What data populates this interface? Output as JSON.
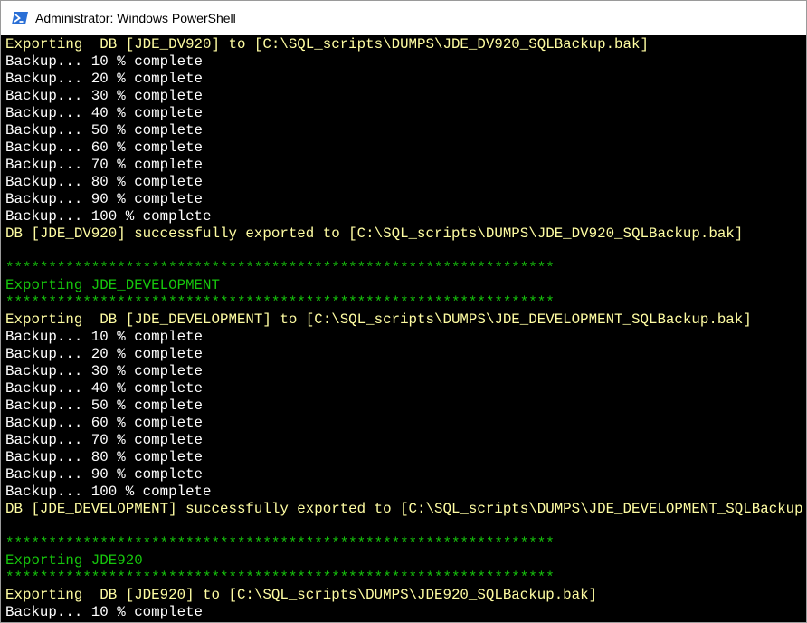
{
  "window": {
    "title": "Administrator: Windows PowerShell",
    "icon": "powershell-icon"
  },
  "colors": {
    "console_bg": "#000000",
    "yellow_text": "#fffda2",
    "green_text": "#16c60c"
  },
  "console": {
    "lines": [
      {
        "text": "Exporting  DB [JDE_DV920] to [C:\\SQL_scripts\\DUMPS\\JDE_DV920_SQLBackup.bak]",
        "color": "yellow"
      },
      {
        "text": "Backup... 10 % complete",
        "color": "white"
      },
      {
        "text": "Backup... 20 % complete",
        "color": "white"
      },
      {
        "text": "Backup... 30 % complete",
        "color": "white"
      },
      {
        "text": "Backup... 40 % complete",
        "color": "white"
      },
      {
        "text": "Backup... 50 % complete",
        "color": "white"
      },
      {
        "text": "Backup... 60 % complete",
        "color": "white"
      },
      {
        "text": "Backup... 70 % complete",
        "color": "white"
      },
      {
        "text": "Backup... 80 % complete",
        "color": "white"
      },
      {
        "text": "Backup... 90 % complete",
        "color": "white"
      },
      {
        "text": "Backup... 100 % complete",
        "color": "white"
      },
      {
        "text": "DB [JDE_DV920] successfully exported to [C:\\SQL_scripts\\DUMPS\\JDE_DV920_SQLBackup.bak]",
        "color": "yellow"
      },
      {
        "text": "",
        "color": "white"
      },
      {
        "text": "****************************************************************",
        "color": "green"
      },
      {
        "text": "Exporting JDE_DEVELOPMENT",
        "color": "green"
      },
      {
        "text": "****************************************************************",
        "color": "green"
      },
      {
        "text": "Exporting  DB [JDE_DEVELOPMENT] to [C:\\SQL_scripts\\DUMPS\\JDE_DEVELOPMENT_SQLBackup.bak]",
        "color": "yellow"
      },
      {
        "text": "Backup... 10 % complete",
        "color": "white"
      },
      {
        "text": "Backup... 20 % complete",
        "color": "white"
      },
      {
        "text": "Backup... 30 % complete",
        "color": "white"
      },
      {
        "text": "Backup... 40 % complete",
        "color": "white"
      },
      {
        "text": "Backup... 50 % complete",
        "color": "white"
      },
      {
        "text": "Backup... 60 % complete",
        "color": "white"
      },
      {
        "text": "Backup... 70 % complete",
        "color": "white"
      },
      {
        "text": "Backup... 80 % complete",
        "color": "white"
      },
      {
        "text": "Backup... 90 % complete",
        "color": "white"
      },
      {
        "text": "Backup... 100 % complete",
        "color": "white"
      },
      {
        "text": "DB [JDE_DEVELOPMENT] successfully exported to [C:\\SQL_scripts\\DUMPS\\JDE_DEVELOPMENT_SQLBackup.",
        "color": "yellow"
      },
      {
        "text": "",
        "color": "white"
      },
      {
        "text": "****************************************************************",
        "color": "green"
      },
      {
        "text": "Exporting JDE920",
        "color": "green"
      },
      {
        "text": "****************************************************************",
        "color": "green"
      },
      {
        "text": "Exporting  DB [JDE920] to [C:\\SQL_scripts\\DUMPS\\JDE920_SQLBackup.bak]",
        "color": "yellow"
      },
      {
        "text": "Backup... 10 % complete",
        "color": "white"
      },
      {
        "text": "Backup... 20 % complete",
        "color": "white"
      }
    ]
  }
}
